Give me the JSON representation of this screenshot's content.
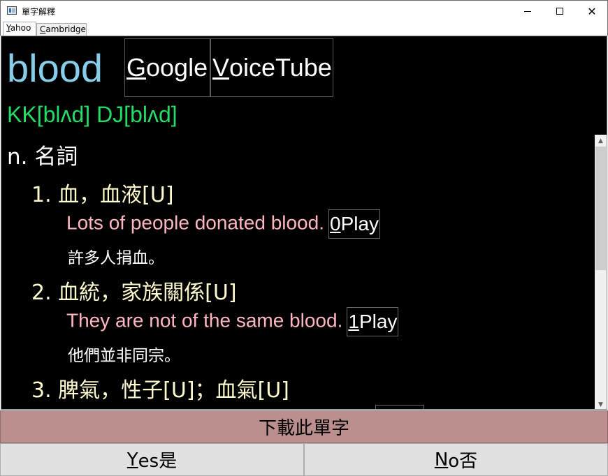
{
  "window": {
    "title": "單字解釋",
    "controls": {
      "minimize": "minimize-icon",
      "maximize": "maximize-icon",
      "close": "close-icon"
    }
  },
  "tabs": [
    {
      "mnemonic": "Y",
      "rest": "ahoo",
      "selected": true
    },
    {
      "mnemonic": "C",
      "rest": "ambridge",
      "selected": false
    }
  ],
  "entry": {
    "word": "blood",
    "google_mnemonic": "G",
    "google_rest": "oogle",
    "voicetube_mnemonic": "V",
    "voicetube_rest": "oiceTube",
    "pronunciation": "KK[blʌd] DJ[blʌd]",
    "part_of_speech": "n. 名詞",
    "senses": [
      {
        "definition": "1. 血，血液[U]",
        "example": "Lots of people donated blood.",
        "play_index": "0",
        "play_label": "Play",
        "translation": "許多人捐血。"
      },
      {
        "definition": "2. 血統，家族關係[U]",
        "example": "They are not of the same blood.",
        "play_index": "1",
        "play_label": "Play",
        "translation": "他們並非同宗。"
      },
      {
        "definition": "3. 脾氣，性子[U]；血氣[U]"
      }
    ]
  },
  "actions": {
    "download": "下載此單字",
    "yes_mnemonic": "Y",
    "yes_rest": "es是",
    "no_mnemonic": "N",
    "no_rest": "o否"
  },
  "colors": {
    "word": "#87ceeb",
    "pronunciation": "#22dd66",
    "definition": "#fffacd",
    "example": "#ffb6c1",
    "download_button": "#bc8f8f"
  }
}
